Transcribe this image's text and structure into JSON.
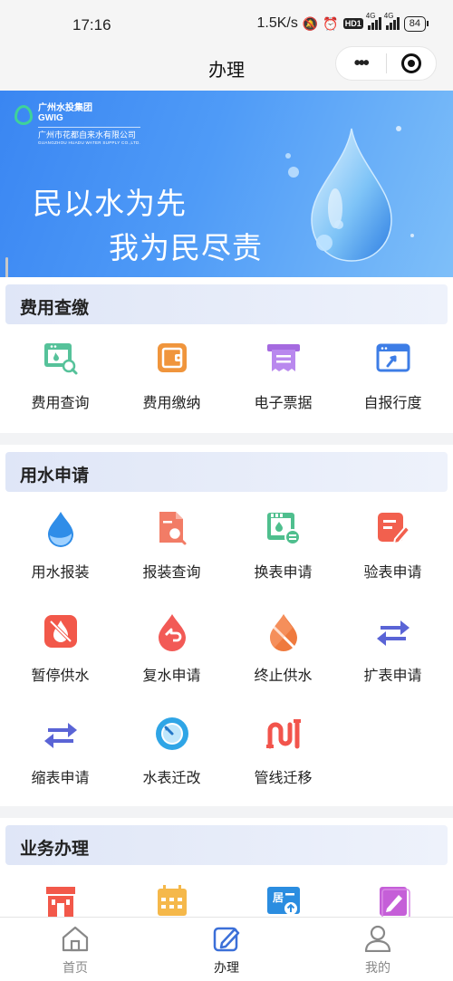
{
  "status_bar": {
    "time": "17:16",
    "net_speed": "1.5K/s",
    "hd_badge": "HD1",
    "net1": "4G",
    "net2": "4G",
    "battery": "84"
  },
  "nav": {
    "title": "办理"
  },
  "banner": {
    "logo_line1": "广州水投集团",
    "logo_line2": "GWIG",
    "logo_line3": "广州市花都自来水有限公司",
    "logo_line4": "GUANGZHOU HUADU WATER SUPPLY CO.,LTD.",
    "slogan1": "民以水为先",
    "slogan2": "我为民尽责"
  },
  "sections": [
    {
      "title": "费用查缴",
      "items": [
        {
          "label": "费用查询",
          "icon": "bill-search-icon"
        },
        {
          "label": "费用缴纳",
          "icon": "wallet-icon"
        },
        {
          "label": "电子票据",
          "icon": "receipt-icon"
        },
        {
          "label": "自报行度",
          "icon": "self-report-icon"
        }
      ]
    },
    {
      "title": "用水申请",
      "items": [
        {
          "label": "用水报装",
          "icon": "water-drop-icon"
        },
        {
          "label": "报装查询",
          "icon": "document-search-icon"
        },
        {
          "label": "换表申请",
          "icon": "meter-exchange-icon"
        },
        {
          "label": "验表申请",
          "icon": "edit-form-icon"
        },
        {
          "label": "暂停供水",
          "icon": "water-off-icon"
        },
        {
          "label": "复水申请",
          "icon": "water-restore-icon"
        },
        {
          "label": "终止供水",
          "icon": "water-stop-icon"
        },
        {
          "label": "扩表申请",
          "icon": "expand-arrows-icon"
        },
        {
          "label": "缩表申请",
          "icon": "shrink-arrows-icon"
        },
        {
          "label": "水表迁改",
          "icon": "gauge-icon"
        },
        {
          "label": "管线迁移",
          "icon": "pipeline-icon"
        }
      ]
    },
    {
      "title": "业务办理",
      "items": [
        {
          "label": "",
          "icon": "store-icon"
        },
        {
          "label": "",
          "icon": "calendar-icon"
        },
        {
          "label": "",
          "icon": "residence-upload-icon"
        },
        {
          "label": "",
          "icon": "pencil-note-icon"
        }
      ]
    }
  ],
  "tabbar": [
    {
      "label": "首页",
      "icon": "home-icon"
    },
    {
      "label": "办理",
      "icon": "edit-icon"
    },
    {
      "label": "我的",
      "icon": "user-icon"
    }
  ],
  "colors": {
    "accent_blue": "#3a86f2",
    "tab_active": "#3b6fd8"
  }
}
